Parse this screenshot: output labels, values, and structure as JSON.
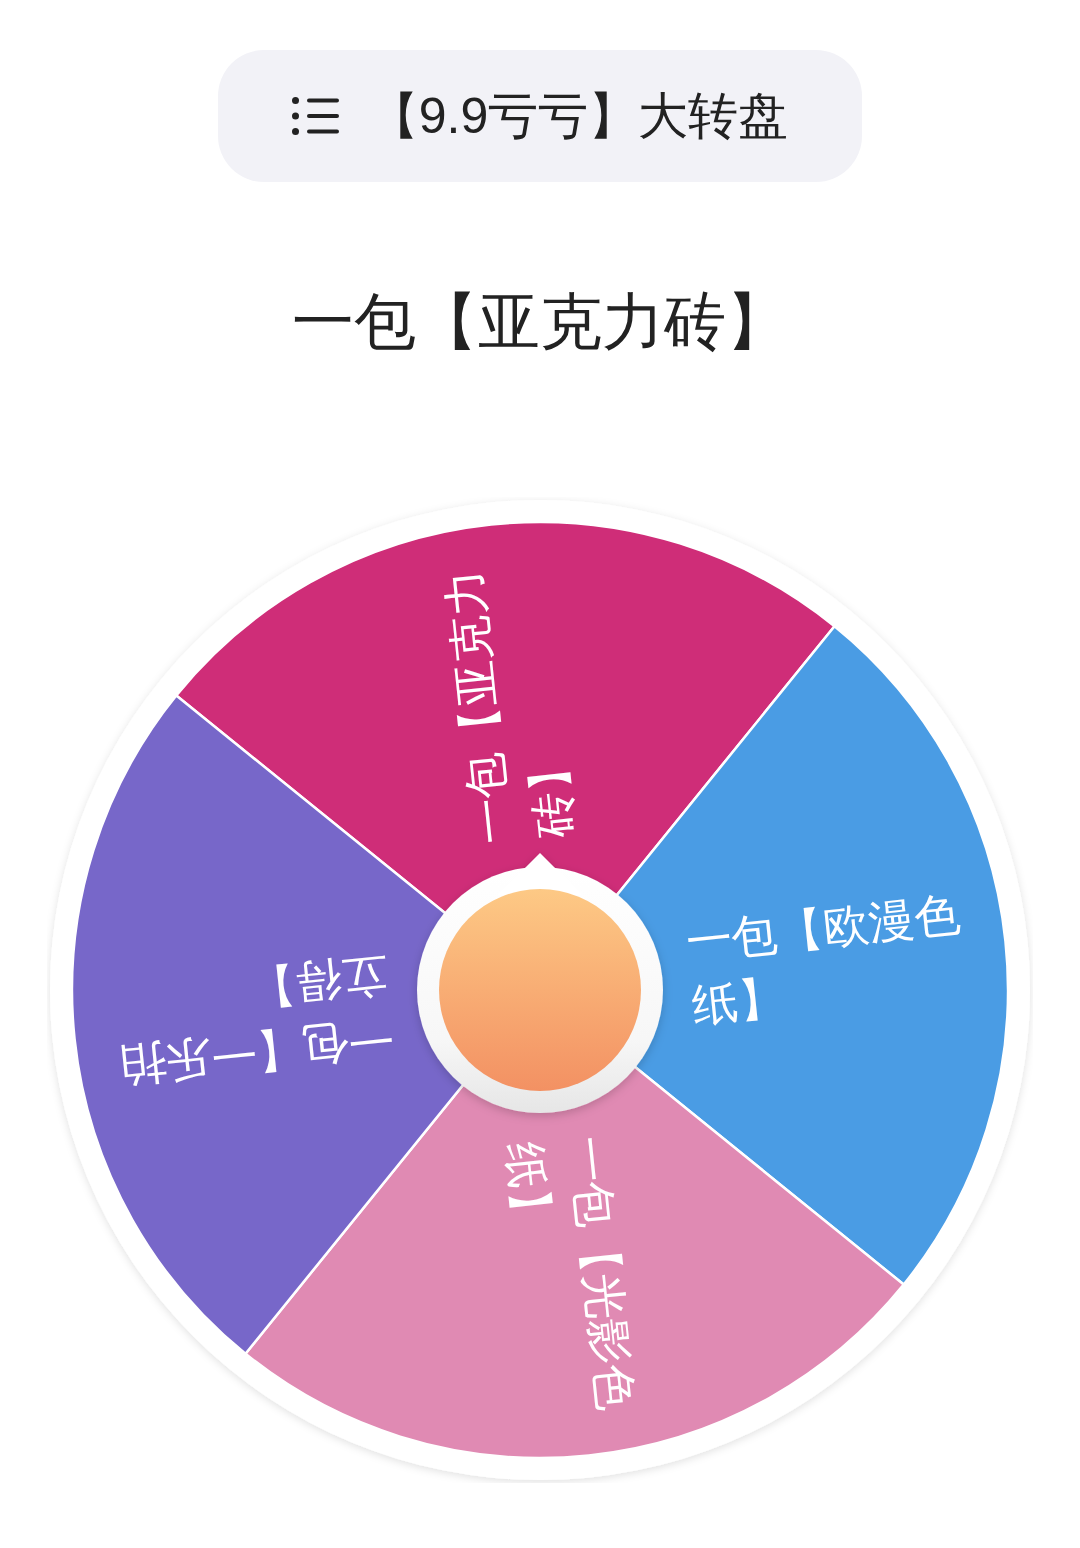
{
  "header": {
    "title": "【9.9亏亏】大转盘"
  },
  "result": {
    "text": "一包【亚克力砖】"
  },
  "wheel": {
    "segments": [
      {
        "label": "一包【亚克力砖】",
        "color": "#cf2d78"
      },
      {
        "label": "一包【欧漫色纸】",
        "color": "#4a9ce4"
      },
      {
        "label": "一包【光影色纸】",
        "color": "#e08ab3"
      },
      {
        "label": "一包【一乐拍立得】",
        "color": "#7767c9"
      }
    ]
  }
}
